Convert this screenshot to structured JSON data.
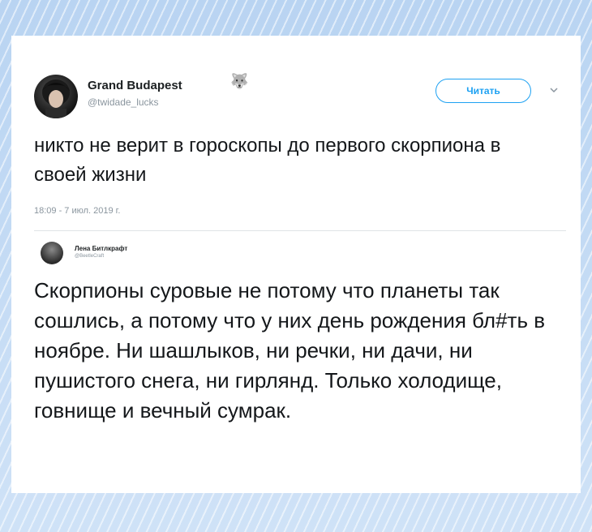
{
  "tweet": {
    "author_name": "Grand Budapest",
    "author_handle": "@twidade_lucks",
    "name_emoji": "🐺",
    "follow_label": "Читать",
    "text": "никто не верит в гороскопы до первого скорпиона в своей жизни",
    "timestamp": "18:09 - 7 июл. 2019 г."
  },
  "quoted": {
    "author_name": "Лена Битлкрафт",
    "author_handle": "@BeetleCraft",
    "text": "Скорпионы суровые не потому что планеты так сошлись, а потому что у них день рождения бл#ть в ноябре. Ни шашлыков, ни речки, ни дачи, ни пушистого снега, ни гирлянд. Только холодище, говнище и вечный сумрак."
  },
  "colors": {
    "accent": "#1da1f2",
    "text": "#14171a",
    "muted": "#8a959e",
    "frame": "#c9def5"
  },
  "icons": {
    "menu": "chevron-down-icon",
    "badge": "wolf-icon"
  }
}
